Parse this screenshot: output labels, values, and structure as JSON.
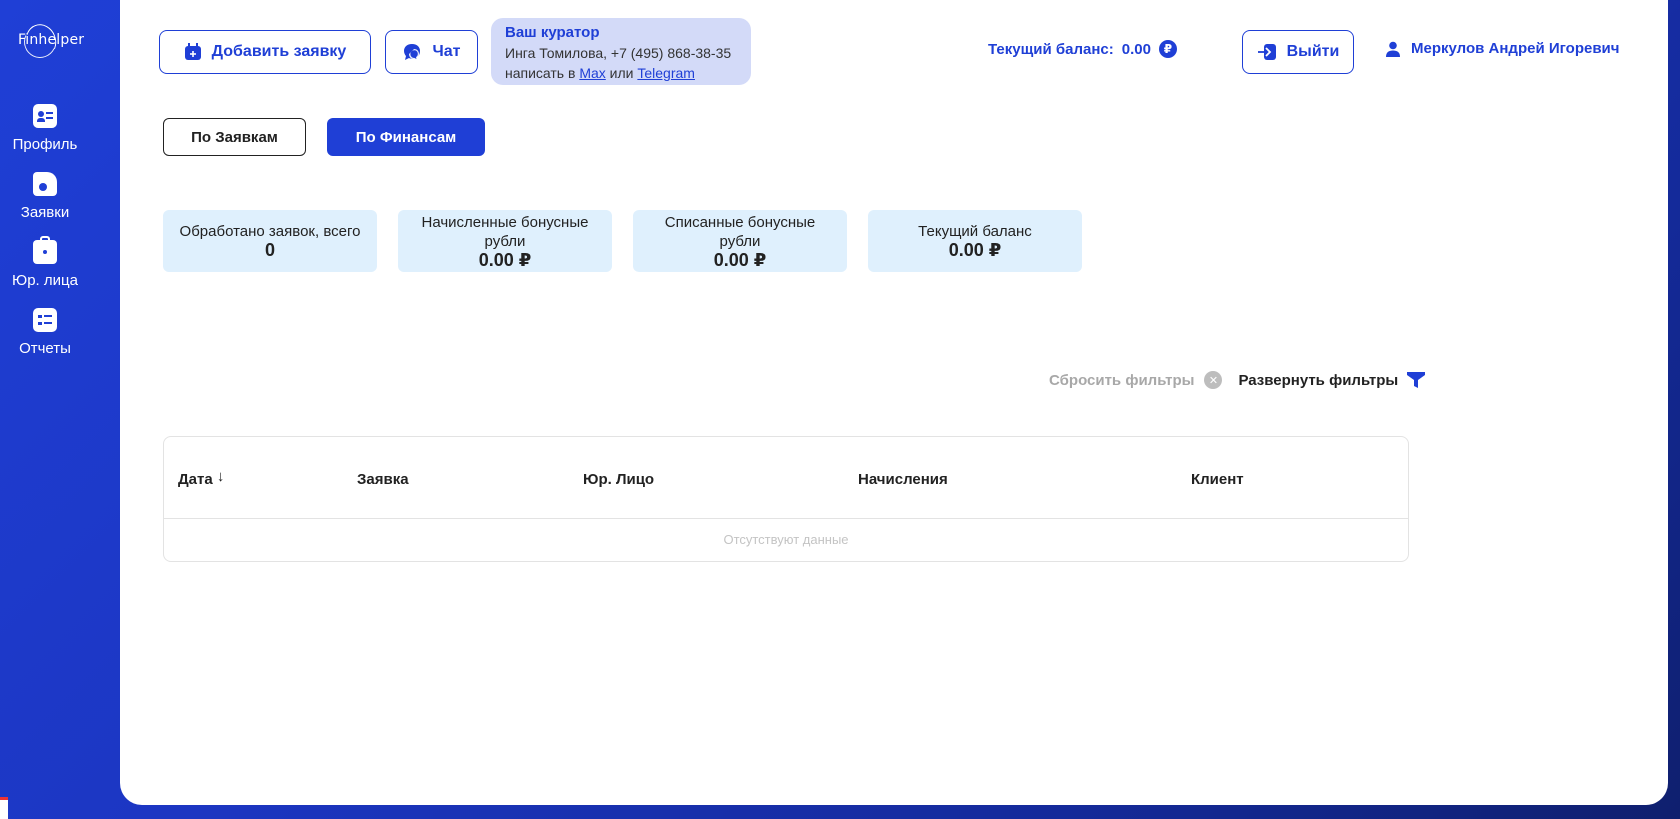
{
  "logo": {
    "text": "Finhelper"
  },
  "sidebar": {
    "items": [
      {
        "label": "Профиль",
        "icon": "profile-card-icon"
      },
      {
        "label": "Заявки",
        "icon": "document-icon"
      },
      {
        "label": "Юр. лица",
        "icon": "briefcase-icon"
      },
      {
        "label": "Отчеты",
        "icon": "checklist-icon"
      }
    ]
  },
  "header": {
    "add_request": "Добавить заявку",
    "chat": "Чат",
    "curator": {
      "title": "Ваш куратор",
      "contact": "Инга Томилова, +7 (495) 868-38-35",
      "write_prefix": "написать в",
      "link_max": "Max",
      "or": "или",
      "link_telegram": "Telegram"
    },
    "balance_label": "Текущий баланс:",
    "balance_value": "0.00",
    "currency_symbol": "₽",
    "logout": "Выйти",
    "user_name": "Меркулов Андрей Игоревич"
  },
  "tabs": {
    "by_requests": "По Заявкам",
    "by_finance": "По Финансам"
  },
  "stats": [
    {
      "label": "Обработано заявок, всего",
      "value": "0"
    },
    {
      "label": "Начисленные бонусные рубли",
      "value": "0.00 ₽"
    },
    {
      "label": "Списанные бонусные рубли",
      "value": "0.00 ₽"
    },
    {
      "label": "Текущий баланс",
      "value": "0.00 ₽"
    }
  ],
  "filters": {
    "reset": "Сбросить фильтры",
    "expand": "Развернуть фильтры"
  },
  "table": {
    "columns": [
      "Дата",
      "Заявка",
      "Юр. Лицо",
      "Начисления",
      "Клиент"
    ],
    "empty_text": "Отсутствуют данные"
  },
  "colors": {
    "accent": "#1f3fd6",
    "card_bg": "#dff0fd",
    "curator_bg": "#d3daf8"
  }
}
